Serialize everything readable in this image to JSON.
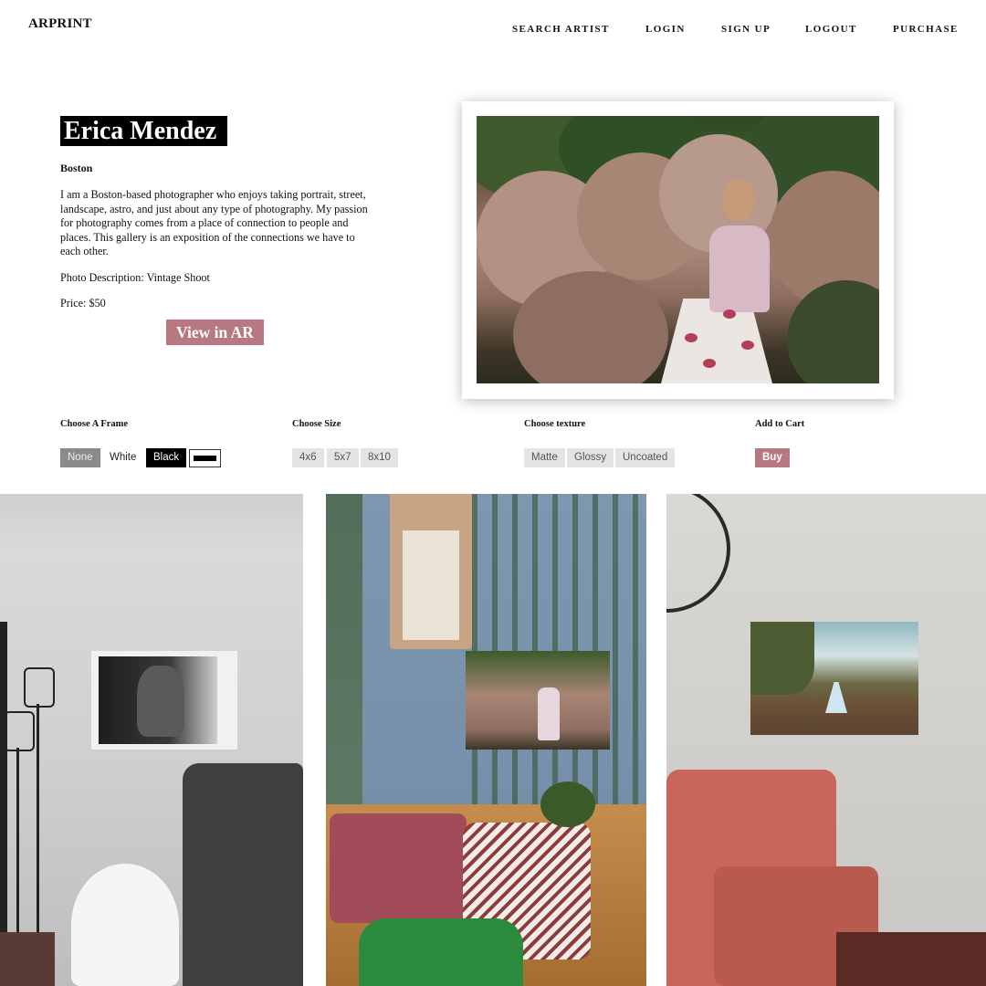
{
  "header": {
    "logo": "ARPRINT",
    "nav": [
      "SEARCH ARTIST",
      "LOGIN",
      "SIGN UP",
      "LOGOUT",
      "PURCHASE"
    ]
  },
  "artist": {
    "name": "Erica Mendez",
    "city": "Boston",
    "bio": "I am a Boston-based photographer who enjoys taking portrait, street, landscape, astro, and just about any type of photography. My passion for photography comes from a place of connection to people and places. This gallery is an exposition of the connections we have to each other.",
    "photo_description": "Photo Description: Vintage Shoot",
    "price": "Price: $50",
    "view_ar_label": "View in AR"
  },
  "options": {
    "frame": {
      "title": "Choose A Frame",
      "choices": [
        "None",
        "White",
        "Black"
      ],
      "selected": "None"
    },
    "size": {
      "title": "Choose Size",
      "choices": [
        "4x6",
        "5x7",
        "8x10"
      ]
    },
    "texture": {
      "title": "Choose texture",
      "choices": [
        "Matte",
        "Glossy",
        "Uncoated"
      ]
    },
    "cart": {
      "title": "Add to Cart",
      "button": "Buy"
    }
  },
  "colors": {
    "accent": "#b87882",
    "selected_chip": "#8a8a8a",
    "chip": "#e4e4e4"
  }
}
